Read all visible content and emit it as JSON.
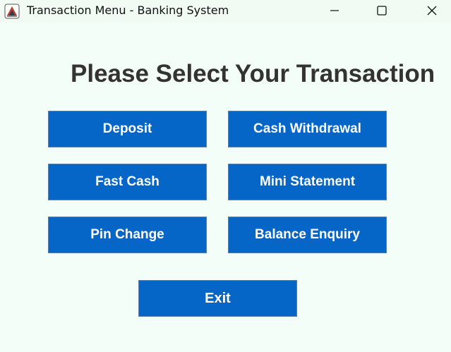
{
  "window": {
    "title": "Transaction Menu - Banking System",
    "icon": "java-app-icon",
    "controls": [
      "minimize-icon",
      "maximize-icon",
      "close-icon"
    ]
  },
  "main": {
    "heading": "Please Select Your Transaction",
    "buttons": {
      "deposit": "Deposit",
      "cash_withdrawal": "Cash Withdrawal",
      "fast_cash": "Fast Cash",
      "mini_statement": "Mini Statement",
      "pin_change": "Pin Change",
      "balance_enquiry": "Balance Enquiry",
      "exit": "Exit"
    }
  },
  "colors": {
    "background": "#f4fef8",
    "button": "#0566c8",
    "button_text": "#ffffff",
    "heading_text": "#333333"
  }
}
